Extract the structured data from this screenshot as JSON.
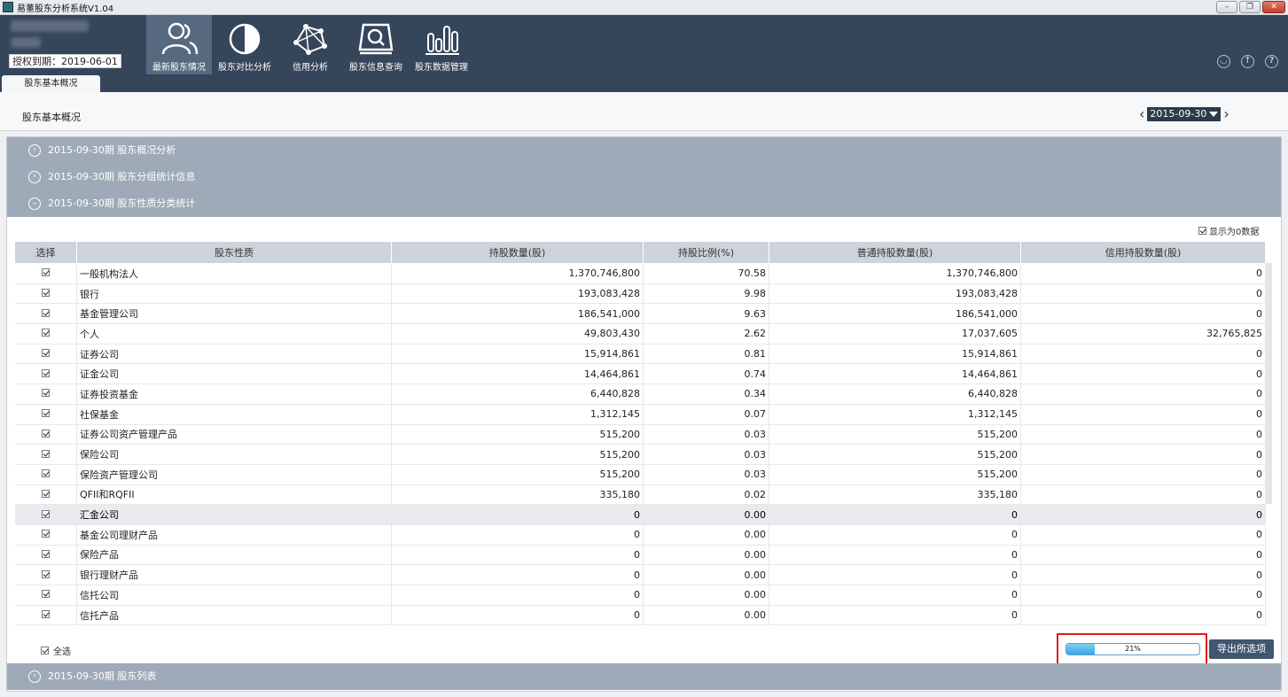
{
  "window": {
    "title": "易董股东分析系统V1.04",
    "buttons": [
      "–",
      "❐",
      "✕"
    ]
  },
  "header": {
    "license_label": "授权到期：2019-06-01",
    "nav": [
      {
        "label": "最新股东情况",
        "icon": "users-icon",
        "active": true
      },
      {
        "label": "股东对比分析",
        "icon": "contrast-icon",
        "active": false
      },
      {
        "label": "信用分析",
        "icon": "network-icon",
        "active": false
      },
      {
        "label": "股东信息查询",
        "icon": "search-monitor-icon",
        "active": false
      },
      {
        "label": "股东数据管理",
        "icon": "bar-chart-icon",
        "active": false
      }
    ],
    "right_icons": [
      "user-icon",
      "upload-icon",
      "help-icon"
    ]
  },
  "page_tab": "股东基本概况",
  "subheader": {
    "title": "股东基本概况",
    "date": "2015-09-30"
  },
  "sections": [
    {
      "label": "2015-09-30期 股东概况分析",
      "expanded": false
    },
    {
      "label": "2015-09-30期 股东分组统计信息",
      "expanded": false
    },
    {
      "label": "2015-09-30期 股东性质分类统计",
      "expanded": true
    },
    {
      "label": "2015-09-30期 股东列表",
      "expanded": false
    }
  ],
  "show_zero_label": "显示为0数据",
  "table": {
    "headers": [
      "选择",
      "股东性质",
      "持股数量(股)",
      "持股比例(%)",
      "普通持股数量(股)",
      "信用持股数量(股)"
    ],
    "rows": [
      [
        "一般机构法人",
        "1,370,746,800",
        "70.58",
        "1,370,746,800",
        "0"
      ],
      [
        "银行",
        "193,083,428",
        "9.98",
        "193,083,428",
        "0"
      ],
      [
        "基金管理公司",
        "186,541,000",
        "9.63",
        "186,541,000",
        "0"
      ],
      [
        "个人",
        "49,803,430",
        "2.62",
        "17,037,605",
        "32,765,825"
      ],
      [
        "证券公司",
        "15,914,861",
        "0.81",
        "15,914,861",
        "0"
      ],
      [
        "证金公司",
        "14,464,861",
        "0.74",
        "14,464,861",
        "0"
      ],
      [
        "证券投资基金",
        "6,440,828",
        "0.34",
        "6,440,828",
        "0"
      ],
      [
        "社保基金",
        "1,312,145",
        "0.07",
        "1,312,145",
        "0"
      ],
      [
        "证券公司资产管理产品",
        "515,200",
        "0.03",
        "515,200",
        "0"
      ],
      [
        "保险公司",
        "515,200",
        "0.03",
        "515,200",
        "0"
      ],
      [
        "保险资产管理公司",
        "515,200",
        "0.03",
        "515,200",
        "0"
      ],
      [
        "QFII和RQFII",
        "335,180",
        "0.02",
        "335,180",
        "0"
      ],
      [
        "汇金公司",
        "0",
        "0.00",
        "0",
        "0"
      ],
      [
        "基金公司理财产品",
        "0",
        "0.00",
        "0",
        "0"
      ],
      [
        "保险产品",
        "0",
        "0.00",
        "0",
        "0"
      ],
      [
        "银行理财产品",
        "0",
        "0.00",
        "0",
        "0"
      ],
      [
        "信托公司",
        "0",
        "0.00",
        "0",
        "0"
      ],
      [
        "信托产品",
        "0",
        "0.00",
        "0",
        "0"
      ]
    ],
    "highlighted_row": 12
  },
  "select_all_label": "全选",
  "progress": {
    "value": 0.21,
    "label": "21%"
  },
  "export_label": "导出所选项"
}
